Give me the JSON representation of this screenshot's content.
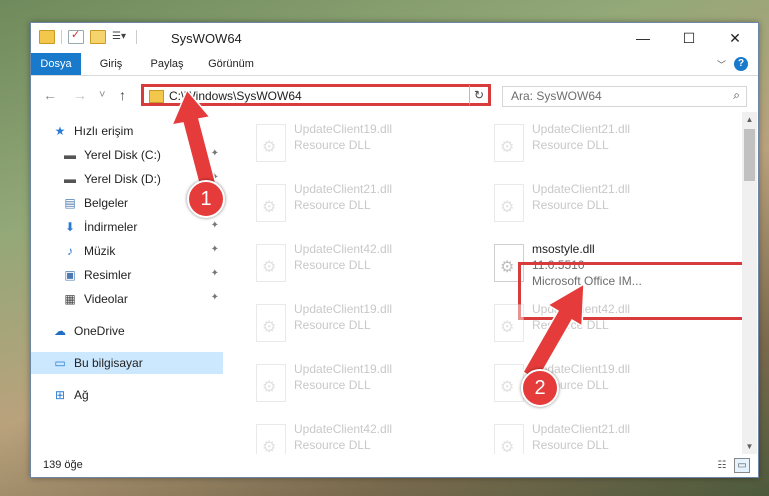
{
  "window": {
    "title": "SysWOW64",
    "controls": {
      "minimize": "—",
      "maximize": "☐",
      "close": "✕"
    }
  },
  "ribbon": {
    "tabs": [
      "Dosya",
      "Giriş",
      "Paylaş",
      "Görünüm"
    ],
    "help": "?"
  },
  "nav": {
    "back": "←",
    "forward": "→",
    "recent": "˅",
    "up": "↑",
    "address": "C:\\Windows\\SysWOW64",
    "refresh": "↻",
    "search_placeholder": "Ara: SysWOW64"
  },
  "sidebar": {
    "items": [
      {
        "label": "Hızlı erişim",
        "icon": "star-icon",
        "glyph": "★"
      },
      {
        "label": "Yerel Disk (C:)",
        "icon": "drive-icon",
        "glyph": "▬",
        "pinned": true
      },
      {
        "label": "Yerel Disk (D:)",
        "icon": "drive-icon",
        "glyph": "▬",
        "pinned": true
      },
      {
        "label": "Belgeler",
        "icon": "documents-icon",
        "glyph": "▤",
        "pinned": true
      },
      {
        "label": "İndirmeler",
        "icon": "downloads-icon",
        "glyph": "⬇",
        "pinned": true
      },
      {
        "label": "Müzik",
        "icon": "music-icon",
        "glyph": "♪",
        "pinned": true
      },
      {
        "label": "Resimler",
        "icon": "pictures-icon",
        "glyph": "▣",
        "pinned": true
      },
      {
        "label": "Videolar",
        "icon": "videos-icon",
        "glyph": "▦",
        "pinned": true
      },
      {
        "label": "OneDrive",
        "icon": "onedrive-icon",
        "glyph": "☁"
      },
      {
        "label": "Bu bilgisayar",
        "icon": "computer-icon",
        "glyph": "▭"
      },
      {
        "label": "Ağ",
        "icon": "network-icon",
        "glyph": "⊞"
      }
    ],
    "pin_glyph": "📌"
  },
  "files": [
    {
      "name": "UpdateClient19.dll",
      "desc": "Resource DLL"
    },
    {
      "name": "UpdateClient21.dll",
      "desc": "Resource DLL"
    },
    {
      "name": "UpdateClient21.dll",
      "desc": "Resource DLL"
    },
    {
      "name": "UpdateClient21.dll",
      "desc": "Resource DLL"
    },
    {
      "name": "UpdateClient42.dll",
      "desc": "Resource DLL"
    },
    {
      "name": "msostyle.dll",
      "version": "11.0.5510",
      "desc": "Microsoft Office IM..."
    },
    {
      "name": "UpdateClient19.dll",
      "desc": "Resource DLL"
    },
    {
      "name": "UpdateClient42.dll",
      "desc": "Resource DLL"
    },
    {
      "name": "UpdateClient19.dll",
      "desc": "Resource DLL"
    },
    {
      "name": "UpdateClient19.dll",
      "desc": "Resource DLL"
    },
    {
      "name": "UpdateClient42.dll",
      "desc": "Resource DLL"
    },
    {
      "name": "UpdateClient21.dll",
      "desc": "Resource DLL"
    }
  ],
  "status": {
    "item_count": "139 öğe"
  },
  "annotations": {
    "step1": "1",
    "step2": "2",
    "color": "#e53b3b"
  },
  "scroll": {
    "up": "▲",
    "down": "▼"
  }
}
